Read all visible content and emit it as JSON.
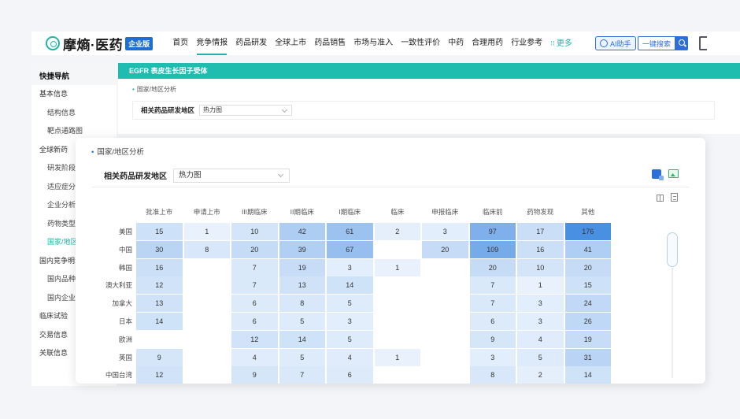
{
  "brand": {
    "name": "摩熵·医药",
    "badge": "企业版"
  },
  "nav": [
    "首页",
    "竞争情报",
    "药品研发",
    "全球上市",
    "药品销售",
    "市场与准入",
    "一致性评价",
    "中药",
    "合理用药",
    "行业参考"
  ],
  "nav_more": "更多",
  "ai_label": "AI助手",
  "search_label": "一键搜索",
  "sidebar": {
    "head": "快捷导航",
    "items": [
      {
        "label": "基本信息",
        "sub": false
      },
      {
        "label": "结构信息",
        "sub": true
      },
      {
        "label": "靶点通路图",
        "sub": true
      },
      {
        "label": "全球新药",
        "sub": false
      },
      {
        "label": "研发阶段:",
        "sub": true
      },
      {
        "label": "适应症分:",
        "sub": true
      },
      {
        "label": "企业分析",
        "sub": true
      },
      {
        "label": "药物类型:",
        "sub": true
      },
      {
        "label": "国家/地区",
        "sub": true
      },
      {
        "label": "国内竞争明:",
        "sub": false
      },
      {
        "label": "国内品种:",
        "sub": true
      },
      {
        "label": "国内企业:",
        "sub": true
      },
      {
        "label": "临床试验",
        "sub": false
      },
      {
        "label": "交易信息",
        "sub": false
      },
      {
        "label": "关联信息",
        "sub": false
      }
    ]
  },
  "target_bar": "EGFR  表皮生长因子受体",
  "bg_crumb": "国家/地区分析",
  "bg_filter_label": "相关药品研发地区",
  "bg_select_value": "热力图",
  "card": {
    "crumb": "国家/地区分析",
    "filter_label": "相关药品研发地区",
    "select_value": "热力图"
  },
  "colors": {
    "accent": "#1fb5a6",
    "brand_blue": "#2d6ed9",
    "heat_high": "#4a90e2",
    "heat_low": "#eef5fd"
  },
  "chart_data": {
    "type": "heatmap",
    "columns": [
      "批准上市",
      "申请上市",
      "III期临床",
      "II期临床",
      "I期临床",
      "临床",
      "申报临床",
      "临床前",
      "药物发现",
      "其他"
    ],
    "rows": [
      "美国",
      "中国",
      "韩国",
      "澳大利亚",
      "加拿大",
      "日本",
      "欧洲",
      "英国",
      "中国台湾"
    ],
    "values": [
      [
        15,
        1,
        10,
        42,
        61,
        2,
        3,
        97,
        17,
        176
      ],
      [
        30,
        8,
        20,
        39,
        67,
        null,
        20,
        109,
        16,
        41
      ],
      [
        16,
        null,
        7,
        19,
        3,
        1,
        null,
        20,
        10,
        20
      ],
      [
        12,
        null,
        7,
        13,
        14,
        null,
        null,
        7,
        1,
        15
      ],
      [
        13,
        null,
        6,
        8,
        5,
        null,
        null,
        7,
        3,
        24
      ],
      [
        14,
        null,
        6,
        5,
        3,
        null,
        null,
        6,
        3,
        26
      ],
      [
        null,
        null,
        12,
        14,
        5,
        null,
        null,
        9,
        4,
        19
      ],
      [
        9,
        null,
        4,
        5,
        4,
        1,
        null,
        3,
        5,
        31
      ],
      [
        12,
        null,
        9,
        7,
        6,
        null,
        null,
        8,
        2,
        14
      ]
    ]
  }
}
